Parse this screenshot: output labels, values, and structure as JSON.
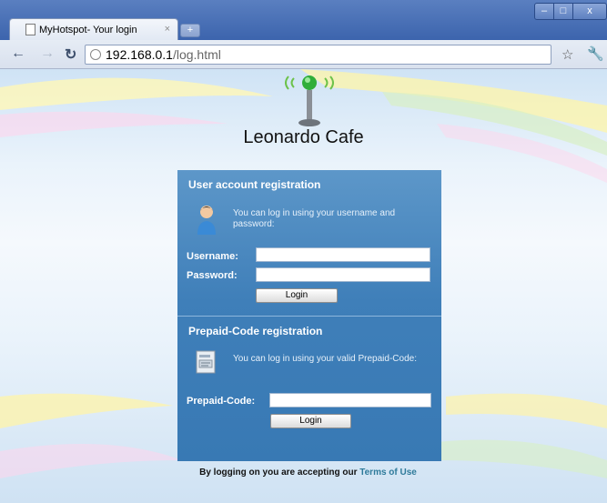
{
  "browser": {
    "tab_title": "MyHotspot- Your login",
    "tab_close": "×",
    "new_tab": "+",
    "url_host": "192.168.0.1",
    "url_path": "/log.html",
    "icons": [
      "page-icon",
      "back-arrow-icon",
      "forward-arrow-icon",
      "reload-icon",
      "site-info-icon",
      "star-icon",
      "wrench-icon",
      "minimize-icon",
      "maximize-icon",
      "close-icon"
    ],
    "window_buttons": {
      "minimize": "–",
      "maximize": "□",
      "close": "x"
    }
  },
  "page": {
    "brand": "Leonardo Cafe",
    "colors": {
      "panel": "#4a88c0",
      "link": "#2e7a9a"
    }
  },
  "user_section": {
    "title": "User account registration",
    "note": "You can log in using your username and password:",
    "username_label": "Username:",
    "username_value": "",
    "password_label": "Password:",
    "password_value": "",
    "login_button": "Login"
  },
  "prepaid_section": {
    "title": "Prepaid-Code registration",
    "note": "You can log in using your valid Prepaid-Code:",
    "code_label": "Prepaid-Code:",
    "code_value": "",
    "login_button": "Login"
  },
  "footer": {
    "terms_text": "By logging on you are accepting our",
    "terms_link": "Terms of Use"
  }
}
